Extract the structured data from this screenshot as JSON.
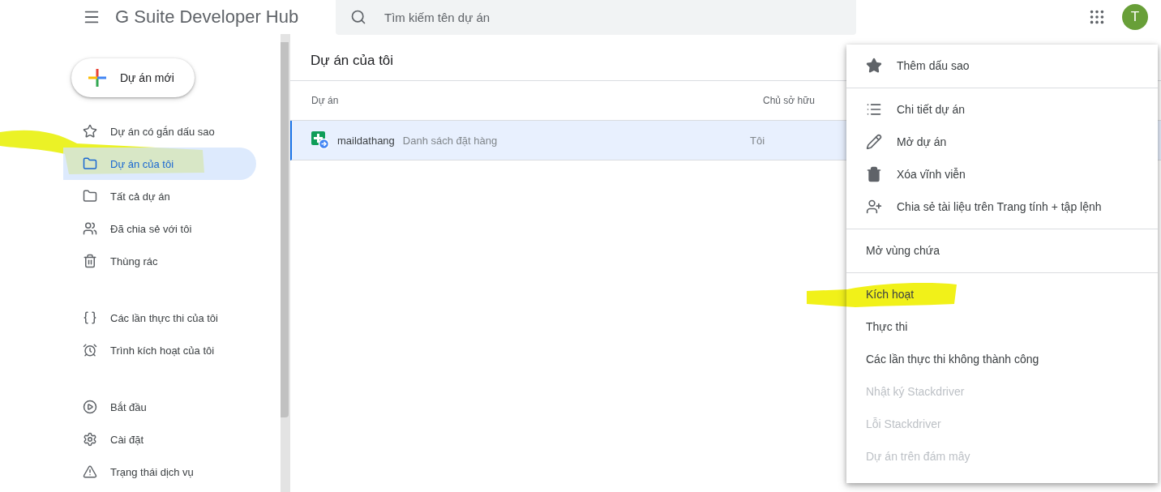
{
  "header": {
    "app_title": "G Suite Developer Hub",
    "search": {
      "placeholder": "Tìm kiếm tên dự án"
    },
    "avatar": "T"
  },
  "sidebar": {
    "new_button": "Dự án mới",
    "groups": [
      [
        {
          "label": "Dự án có gắn dấu sao",
          "selected": false
        },
        {
          "label": "Dự án của tôi",
          "selected": true
        },
        {
          "label": "Tất cả dự án",
          "selected": false
        },
        {
          "label": "Đã chia sẻ với tôi",
          "selected": false
        },
        {
          "label": "Thùng rác",
          "selected": false
        }
      ],
      [
        {
          "label": "Các lần thực thi của tôi",
          "selected": false
        },
        {
          "label": "Trình kích hoạt của tôi",
          "selected": false
        }
      ],
      [
        {
          "label": "Bắt đầu",
          "selected": false
        },
        {
          "label": "Cài đặt",
          "selected": false
        },
        {
          "label": "Trạng thái dịch vụ",
          "selected": false
        }
      ]
    ]
  },
  "main": {
    "title": "Dự án của tôi",
    "columns": [
      "Dự án",
      "Chủ sở hữu"
    ],
    "rows": [
      {
        "name": "maildathang",
        "description": "Danh sách đặt hàng",
        "owner": "Tôi",
        "selected": true
      }
    ]
  },
  "context_menu": {
    "sections": [
      [
        {
          "label": "Thêm dấu sao",
          "disabled": false
        }
      ],
      [
        {
          "label": "Chi tiết dự án",
          "disabled": false
        },
        {
          "label": "Mở dự án",
          "disabled": false
        },
        {
          "label": "Xóa vĩnh viễn",
          "disabled": false
        },
        {
          "label": "Chia sẻ tài liệu trên Trang tính + tập lệnh",
          "disabled": false
        }
      ],
      [
        {
          "label": "Mở vùng chứa",
          "disabled": false
        }
      ],
      [
        {
          "label": "Kích hoạt",
          "disabled": false
        },
        {
          "label": "Thực thi",
          "disabled": false
        },
        {
          "label": "Các lần thực thi không thành công",
          "disabled": false
        },
        {
          "label": "Nhật ký Stackdriver",
          "disabled": true
        },
        {
          "label": "Lỗi Stackdriver",
          "disabled": true
        },
        {
          "label": "Dự án trên đám mây",
          "disabled": true
        }
      ]
    ]
  }
}
